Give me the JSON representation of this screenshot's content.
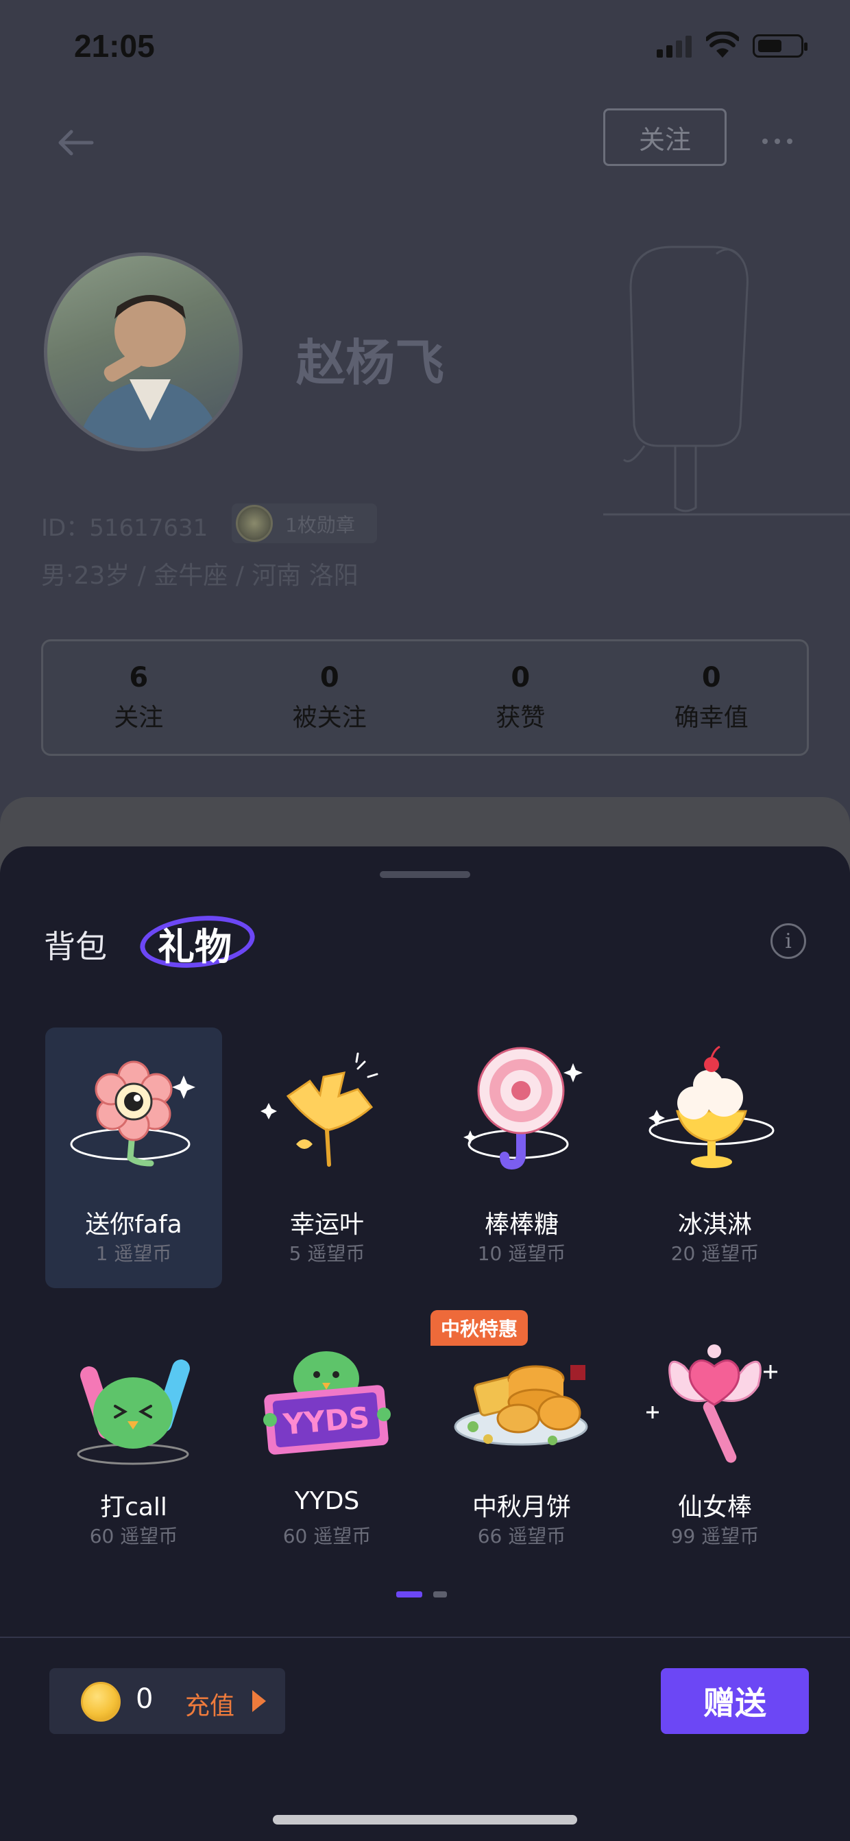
{
  "status_bar": {
    "time": "21:05"
  },
  "header": {
    "follow_label": "关注"
  },
  "profile": {
    "name": "赵杨飞",
    "id_text": "ID：51617631",
    "medal_text": "1枚勋章",
    "info": "男·23岁 / 金牛座 / 河南 洛阳"
  },
  "stats": [
    {
      "value": "6",
      "label": "关注"
    },
    {
      "value": "0",
      "label": "被关注"
    },
    {
      "value": "0",
      "label": "获赞"
    },
    {
      "value": "0",
      "label": "确幸值"
    }
  ],
  "sheet": {
    "tabs": [
      {
        "label": "背包",
        "active": false
      },
      {
        "label": "礼物",
        "active": true
      }
    ],
    "info_icon": "i",
    "promo_badge": "中秋特惠",
    "gifts": [
      {
        "name": "送你fafa",
        "price": "1 遥望币",
        "icon": "flower-icon",
        "selected": true
      },
      {
        "name": "幸运叶",
        "price": "5 遥望币",
        "icon": "ginkgo-leaf-icon"
      },
      {
        "name": "棒棒糖",
        "price": "10 遥望币",
        "icon": "lollipop-icon"
      },
      {
        "name": "冰淇淋",
        "price": "20 遥望币",
        "icon": "ice-cream-icon"
      },
      {
        "name": "打call",
        "price": "60 遥望币",
        "icon": "glow-stick-bird-icon"
      },
      {
        "name": "YYDS",
        "price": "60 遥望币",
        "icon": "yyds-sign-icon"
      },
      {
        "name": "中秋月饼",
        "price": "66 遥望币",
        "icon": "mooncake-icon"
      },
      {
        "name": "仙女棒",
        "price": "99 遥望币",
        "icon": "fairy-wand-icon"
      }
    ],
    "page_indicator": {
      "current": 1,
      "total": 2
    }
  },
  "bottom_bar": {
    "balance": "0",
    "recharge_label": "充值",
    "send_label": "赠送"
  },
  "colors": {
    "accent": "#6c47f5",
    "recharge": "#ee7b3c",
    "sheet_bg": "#1b1c2a"
  }
}
